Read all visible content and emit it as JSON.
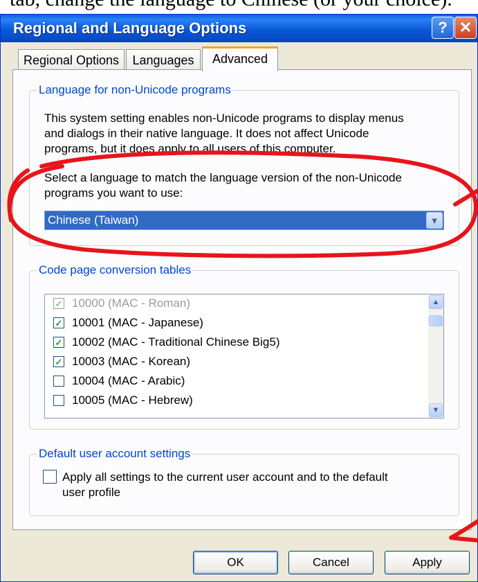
{
  "caption": "tab, change the language to Chinese (or your choice).",
  "window": {
    "title": "Regional and Language Options",
    "help_glyph": "?",
    "close_glyph": "✕"
  },
  "tabs": [
    {
      "label": "Regional Options",
      "active": false
    },
    {
      "label": "Languages",
      "active": false
    },
    {
      "label": "Advanced",
      "active": true
    }
  ],
  "non_unicode": {
    "legend": "Language for non-Unicode programs",
    "description_lines": [
      "This system setting enables non-Unicode programs to display menus",
      "and dialogs in their native language. It does not affect Unicode",
      "programs, but it does apply to all users of this computer."
    ],
    "select_prompt_lines": [
      "Select a language to match the language version of the non-Unicode",
      "programs you want to use:"
    ],
    "selected_language": "Chinese (Taiwan)"
  },
  "code_page": {
    "legend": "Code page conversion tables",
    "items": [
      {
        "label": "10000 (MAC - Roman)",
        "checked": true,
        "disabled": true
      },
      {
        "label": "10001 (MAC - Japanese)",
        "checked": true,
        "disabled": false
      },
      {
        "label": "10002 (MAC - Traditional Chinese Big5)",
        "checked": true,
        "disabled": false
      },
      {
        "label": "10003 (MAC - Korean)",
        "checked": true,
        "disabled": false
      },
      {
        "label": "10004 (MAC - Arabic)",
        "checked": false,
        "disabled": false
      },
      {
        "label": "10005 (MAC - Hebrew)",
        "checked": false,
        "disabled": false
      }
    ]
  },
  "default_user": {
    "legend": "Default user account settings",
    "checkbox_lines": [
      "Apply all settings to the current user account and to the default",
      "user profile"
    ],
    "checked": false
  },
  "buttons": {
    "ok": "OK",
    "cancel": "Cancel",
    "apply": "Apply"
  },
  "colors": {
    "annotation": "#e8141b",
    "titlebar": "#0a58d8",
    "group_legend": "#0046d5"
  }
}
